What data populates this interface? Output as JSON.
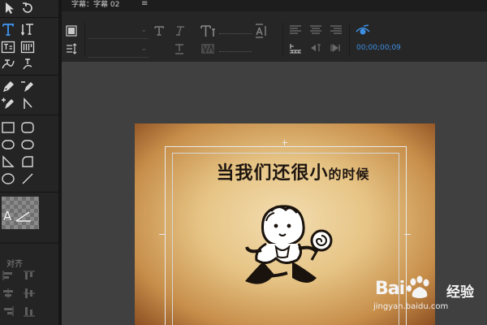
{
  "panel": {
    "title": "字幕：字幕 02",
    "menu_glyph": "≡"
  },
  "tools": [
    {
      "id": "selection",
      "icon": "arrow-cursor-icon"
    },
    {
      "id": "rotation",
      "icon": "rotate-icon"
    },
    {
      "id": "type",
      "icon": "horizontal-type-icon",
      "active": true
    },
    {
      "id": "vertical-type",
      "icon": "vertical-type-icon"
    },
    {
      "id": "area-type",
      "icon": "area-type-icon"
    },
    {
      "id": "vertical-area-type",
      "icon": "vertical-area-type-icon"
    },
    {
      "id": "path-type",
      "icon": "path-type-icon"
    },
    {
      "id": "vertical-path-type",
      "icon": "vertical-path-type-icon"
    },
    {
      "id": "pen",
      "icon": "pen-icon"
    },
    {
      "id": "delete-anchor",
      "icon": "delete-anchor-icon"
    },
    {
      "id": "add-anchor",
      "icon": "add-anchor-icon"
    },
    {
      "id": "convert-anchor",
      "icon": "convert-anchor-icon"
    },
    {
      "id": "rectangle",
      "icon": "rectangle-icon"
    },
    {
      "id": "rounded-rectangle",
      "icon": "rounded-rectangle-icon"
    },
    {
      "id": "ellipse-rounded",
      "icon": "clipped-rect-icon"
    },
    {
      "id": "rounded-rect-2",
      "icon": "rounded-rect-2-icon"
    },
    {
      "id": "wedge",
      "icon": "wedge-icon"
    },
    {
      "id": "arc",
      "icon": "arc-icon"
    },
    {
      "id": "ellipse",
      "icon": "ellipse-icon"
    },
    {
      "id": "line",
      "icon": "line-icon"
    }
  ],
  "style_preview": {
    "label": "A"
  },
  "align_section": {
    "label": "对齐"
  },
  "toolbar": {
    "timecode": "00;00;00;09"
  },
  "caption": {
    "text_large": "当我们还很小",
    "text_small": "的时候"
  },
  "watermark": {
    "brand": "Bai",
    "brand_end": "经验",
    "url": "jingyan.baidu.com"
  },
  "colors": {
    "accent": "#3d8fe4",
    "panel_bg": "#242424",
    "canvas_bg": "#404040"
  }
}
